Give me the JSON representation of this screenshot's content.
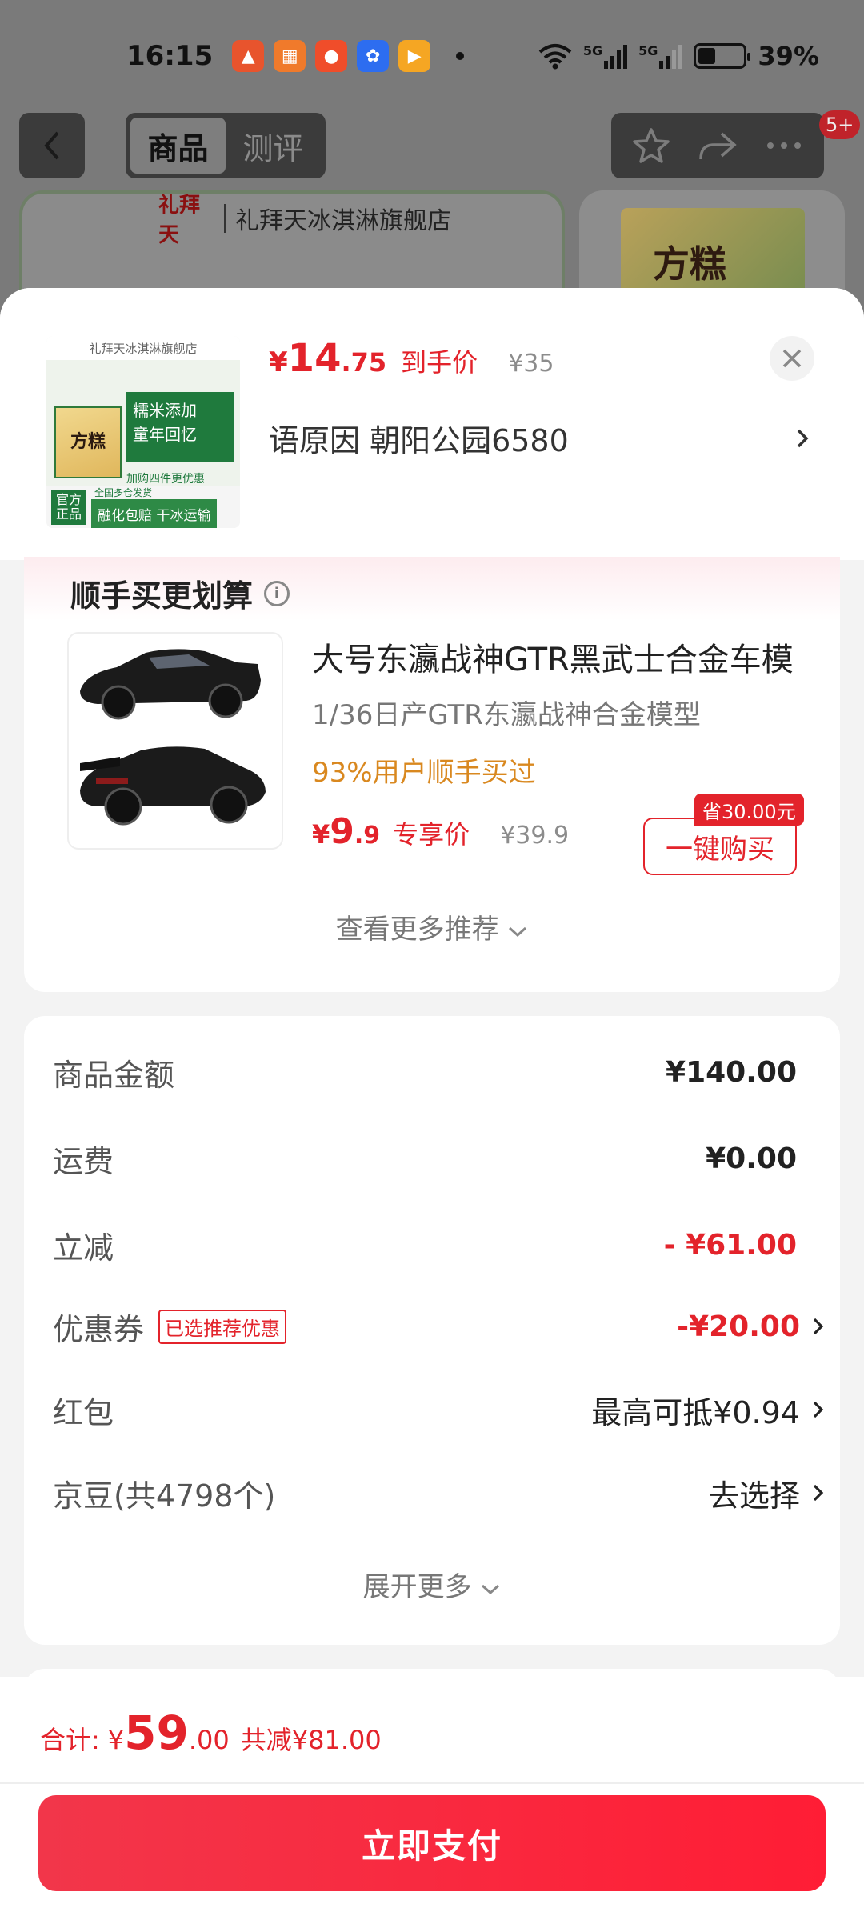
{
  "status_bar": {
    "time": "16:15",
    "net1": "5G",
    "net2": "5G",
    "battery": "39%",
    "battery_level": 0.39
  },
  "header": {
    "tabs": [
      "商品",
      "测评"
    ],
    "active_tab": 0,
    "badge": "5+",
    "store_name": "礼拜天冰淇淋旗舰店",
    "store_logo": "礼拜天",
    "peek_product": "方糕"
  },
  "product": {
    "price_yen": "¥",
    "price_int": "14",
    "price_dec": ".75",
    "price_label": "到手价",
    "original_price": "¥35",
    "spec": "语原因  朝阳公园6580",
    "thumb": {
      "store": "礼拜天冰淇淋旗舰店",
      "pack": "方糕",
      "slogan1": "糯米添加",
      "slogan2": "童年回忆",
      "note": "加购四件更优惠",
      "tag1": "官方",
      "tag2": "正品",
      "foot": "融化包赔 干冰运输",
      "foot_top": "全国多仓发货"
    }
  },
  "recommend": {
    "title": "顺手买更划算",
    "name": "大号东瀛战神GTR黑武士合金车模",
    "subtitle": "1/36日产GTR东瀛战神合金模型",
    "rate": "93%用户顺手买过",
    "price_yen": "¥",
    "price_int": "9",
    "price_dec": ".9",
    "price_label": "专享价",
    "original_price": "¥39.9",
    "save_tag": "省30.00元",
    "buy_label": "一键购买",
    "more": "查看更多推荐"
  },
  "summary": {
    "rows": [
      {
        "label": "商品金额",
        "value": "¥140.00"
      },
      {
        "label": "运费",
        "value": "¥0.00"
      },
      {
        "label": "立减",
        "value": "- ¥61.00"
      },
      {
        "label": "优惠券",
        "tag": "已选推荐优惠",
        "value": "-¥20.00"
      },
      {
        "label": "红包",
        "value": "最高可抵¥0.94"
      },
      {
        "label": "京豆(共4798个)",
        "value": "去选择"
      }
    ],
    "expand": "展开更多"
  },
  "footer": {
    "total_label": "合计:",
    "yen": "¥",
    "total_int": "59",
    "total_dec": ".00",
    "saved": "共减¥81.00",
    "pay_label": "立即支付"
  },
  "colors": {
    "accent": "#e3232b",
    "rate": "#d9881f",
    "pay_gradient_start": "#f2364a",
    "pay_gradient_end": "#ff1d35"
  }
}
